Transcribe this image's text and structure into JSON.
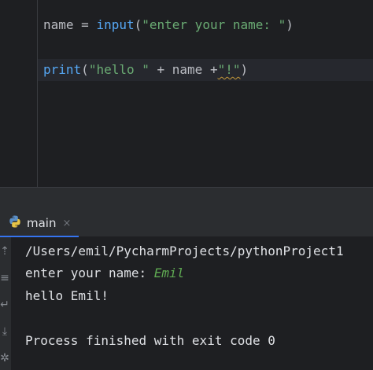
{
  "editor": {
    "line1": {
      "var": "name",
      "op": " = ",
      "fn": "input",
      "open": "(",
      "arg": "\"enter your name: \"",
      "close": ")"
    },
    "line2": {
      "fn": "print",
      "open": "(",
      "str1": "\"hello \"",
      "mid": " + name +",
      "str2": "\"!\"",
      "close": ")"
    }
  },
  "run_panel": {
    "tab_label": "main",
    "tab_close": "×",
    "icons": [
      "python-icon",
      "close-icon",
      "scroll-icon",
      "soft-wrap-icon",
      "debug-icon"
    ]
  },
  "console": {
    "path_line": "/Users/emil/PycharmProjects/pythonProject1",
    "prompt": "enter your name: ",
    "user_input": "Emil",
    "greeting": "hello Emil!",
    "exit_line": "Process finished with exit code 0"
  },
  "colors": {
    "editor_bg": "#1e1f22",
    "panel_bg": "#2b2d30",
    "function": "#56a8f5",
    "string": "#6aab73",
    "input_text": "#5faa52",
    "tab_underline": "#3574f0"
  }
}
